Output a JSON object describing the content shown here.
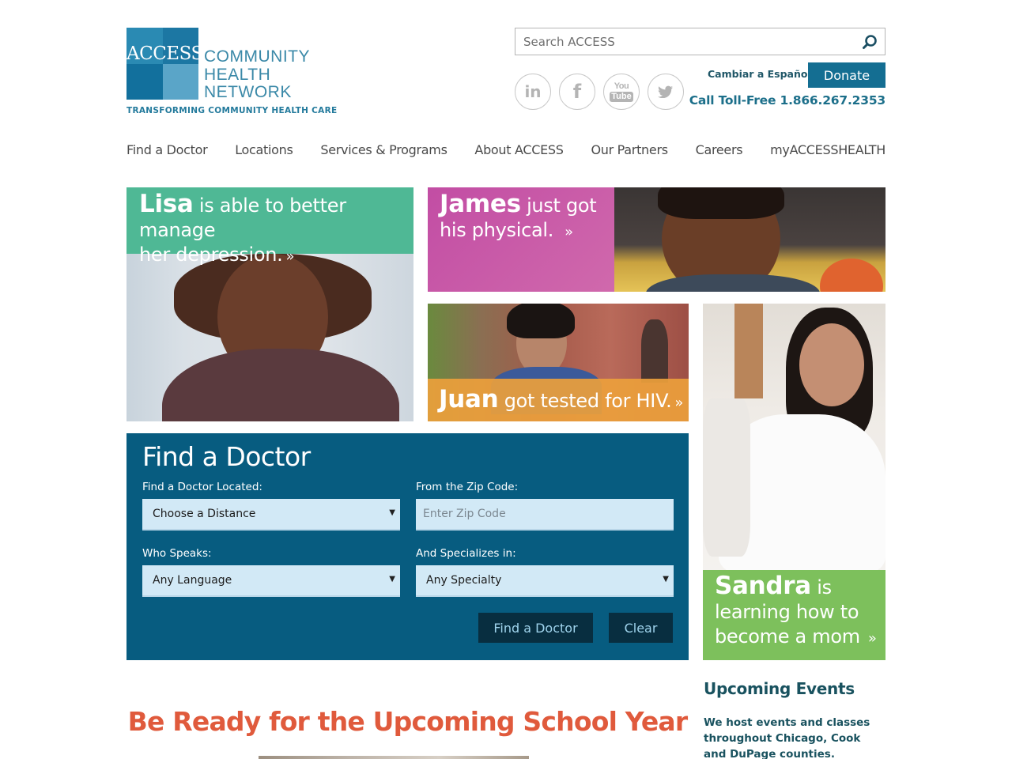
{
  "header": {
    "logo": {
      "word": "ACCESS",
      "name_lines": [
        "COMMUNITY",
        "HEALTH",
        "NETWORK"
      ],
      "tagline": "TRANSFORMING COMMUNITY HEALTH CARE"
    },
    "search": {
      "placeholder": "Search ACCESS",
      "value": "",
      "icon": "search-icon"
    },
    "social": [
      {
        "name": "LinkedIn",
        "icon": "linkedin-icon",
        "glyph": "in"
      },
      {
        "name": "Facebook",
        "icon": "facebook-icon",
        "glyph": "f"
      },
      {
        "name": "YouTube",
        "icon": "youtube-icon",
        "glyph_top": "You",
        "glyph_bottom": "Tube"
      },
      {
        "name": "Twitter",
        "icon": "twitter-icon"
      }
    ],
    "language_link": "Cambiar a Español",
    "donate_label": "Donate",
    "toll_free": "Call Toll-Free 1.866.267.2353",
    "colors": {
      "brand_blue": "#146e92",
      "text_teal": "#1c6f8a"
    }
  },
  "nav": {
    "items": [
      {
        "label": "Find a Doctor"
      },
      {
        "label": "Locations"
      },
      {
        "label": "Services & Programs"
      },
      {
        "label": "About ACCESS"
      },
      {
        "label": "Our Partners"
      },
      {
        "label": "Careers"
      },
      {
        "label": "myACCESSHEALTH"
      }
    ]
  },
  "stories": {
    "lisa": {
      "name": "Lisa",
      "text_line1": " is able to better manage",
      "text_line2": "her depression.",
      "arrow": "»",
      "color": "#4fb895"
    },
    "james": {
      "name": "James",
      "text_line1": " just got",
      "text_line2": "his physical.",
      "arrow": "»",
      "color": "#c24da4"
    },
    "juan": {
      "name": "Juan",
      "text_line1": " got tested for HIV.",
      "arrow": "»",
      "color": "#eca03c"
    },
    "sandra": {
      "name": "Sandra",
      "text_line1": " is",
      "text_line2": "learning how to",
      "text_line3": "become a mom",
      "arrow": "»",
      "color": "#7dc05c"
    }
  },
  "find_doctor": {
    "title": "Find a Doctor",
    "located_label": "Find a Doctor Located:",
    "distance_value": "Choose a Distance",
    "zip_label": "From the Zip Code:",
    "zip_placeholder": "Enter Zip Code",
    "zip_value": "",
    "speaks_label": "Who Speaks:",
    "language_value": "Any Language",
    "specializes_label": "And Specializes in:",
    "specialty_value": "Any Specialty",
    "submit_label": "Find a Doctor",
    "clear_label": "Clear",
    "panel_color": "#075c80"
  },
  "promo": {
    "title": "Be Ready for the Upcoming School Year",
    "title_color": "#e05a3c"
  },
  "events": {
    "title": "Upcoming Events",
    "text": "We host events and classes throughout Chicago, Cook and DuPage counties."
  }
}
